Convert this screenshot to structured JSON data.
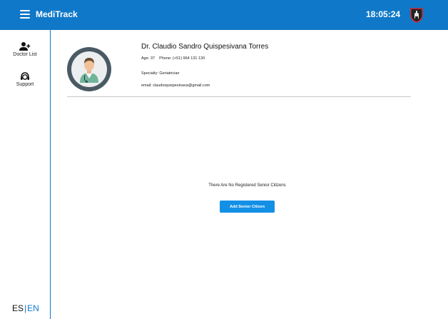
{
  "app": {
    "title": "MediTrack",
    "time": "18:05:24"
  },
  "sidebar": {
    "items": [
      {
        "label": "Doctor List",
        "icon": "add-user-icon"
      },
      {
        "label": "Support",
        "icon": "support-agent-icon"
      }
    ],
    "language": {
      "es": "ES",
      "separator": "|",
      "en": "EN",
      "active": "EN"
    }
  },
  "doctor": {
    "name": "Dr. Claudio Sandro Quispesivana Torres",
    "age_phone": "Age: 37    Phone: (+51) 964 131 130",
    "specialty": "Specialty: Geriatrician",
    "email": "email: claudioquispesinava@gmail.com",
    "avatar_icon": "doctor-avatar-icon"
  },
  "main": {
    "empty_message": "There Are No Registered Senior Citizens",
    "add_button": "Add Senior Citizen"
  },
  "colors": {
    "primary": "#1078c8",
    "button": "#1390e6",
    "avatar_ring": "#4a5a63"
  }
}
